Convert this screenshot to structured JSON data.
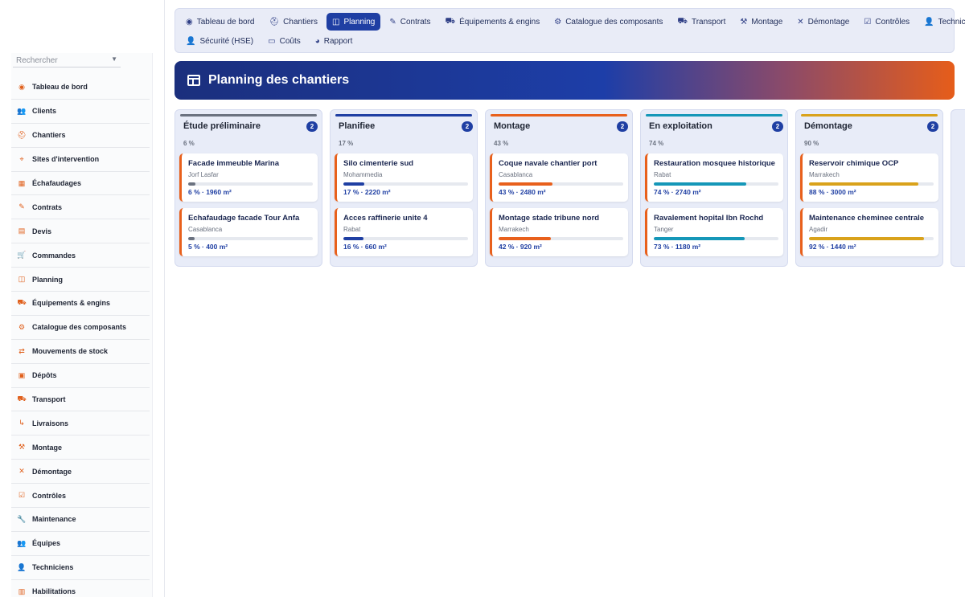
{
  "sidebar": {
    "search_placeholder": "Rechercher",
    "items": [
      {
        "label": "Tableau de bord",
        "icon": "dashboard-icon",
        "glyph": "◉"
      },
      {
        "label": "Clients",
        "icon": "users-icon",
        "glyph": "👥"
      },
      {
        "label": "Chantiers",
        "icon": "helmet-icon",
        "glyph": "⛑"
      },
      {
        "label": "Sites d'intervention",
        "icon": "map-pin-icon",
        "glyph": "⌖"
      },
      {
        "label": "Échafaudages",
        "icon": "grid-icon",
        "glyph": "▦"
      },
      {
        "label": "Contrats",
        "icon": "contract-icon",
        "glyph": "✎"
      },
      {
        "label": "Devis",
        "icon": "document-icon",
        "glyph": "▤"
      },
      {
        "label": "Commandes",
        "icon": "cart-icon",
        "glyph": "🛒"
      },
      {
        "label": "Planning",
        "icon": "calendar-icon",
        "glyph": "◫"
      },
      {
        "label": "Équipements & engins",
        "icon": "truck-icon",
        "glyph": "⛟"
      },
      {
        "label": "Catalogue des composants",
        "icon": "components-icon",
        "glyph": "⚙"
      },
      {
        "label": "Mouvements de stock",
        "icon": "exchange-icon",
        "glyph": "⇄"
      },
      {
        "label": "Dépôts",
        "icon": "warehouse-icon",
        "glyph": "▣"
      },
      {
        "label": "Transport",
        "icon": "transport-icon",
        "glyph": "⛟"
      },
      {
        "label": "Livraisons",
        "icon": "dolly-icon",
        "glyph": "↳"
      },
      {
        "label": "Montage",
        "icon": "hammer-icon",
        "glyph": "⚒"
      },
      {
        "label": "Démontage",
        "icon": "tools-icon",
        "glyph": "✕"
      },
      {
        "label": "Contrôles",
        "icon": "clipboard-check-icon",
        "glyph": "☑"
      },
      {
        "label": "Maintenance",
        "icon": "wrench-icon",
        "glyph": "🔧"
      },
      {
        "label": "Équipes",
        "icon": "team-icon",
        "glyph": "👥"
      },
      {
        "label": "Techniciens",
        "icon": "technician-icon",
        "glyph": "👤"
      },
      {
        "label": "Habilitations",
        "icon": "certificate-icon",
        "glyph": "▥"
      }
    ]
  },
  "topnav": {
    "row1": [
      {
        "label": "Tableau de bord",
        "icon": "dashboard-icon",
        "glyph": "◉",
        "active": false
      },
      {
        "label": "Chantiers",
        "icon": "helmet-icon",
        "glyph": "⛑",
        "active": false
      },
      {
        "label": "Planning",
        "icon": "calendar-icon",
        "glyph": "◫",
        "active": true
      },
      {
        "label": "Contrats",
        "icon": "contract-icon",
        "glyph": "✎",
        "active": false
      },
      {
        "label": "Équipements & engins",
        "icon": "truck-icon",
        "glyph": "⛟",
        "active": false
      },
      {
        "label": "Catalogue des composants",
        "icon": "components-icon",
        "glyph": "⚙",
        "active": false
      },
      {
        "label": "Transport",
        "icon": "transport-icon",
        "glyph": "⛟",
        "active": false
      },
      {
        "label": "Montage",
        "icon": "hammer-icon",
        "glyph": "⚒",
        "active": false
      },
      {
        "label": "Démontage",
        "icon": "tools-icon",
        "glyph": "✕",
        "active": false
      },
      {
        "label": "Contrôles",
        "icon": "clipboard-check-icon",
        "glyph": "☑",
        "active": false
      },
      {
        "label": "Techniciens",
        "icon": "technician-icon",
        "glyph": "👤",
        "active": false
      }
    ],
    "row2": [
      {
        "label": "Sécurité (HSE)",
        "icon": "safety-icon",
        "glyph": "👤",
        "active": false
      },
      {
        "label": "Coûts",
        "icon": "wallet-icon",
        "glyph": "▭",
        "active": false
      },
      {
        "label": "Rapport",
        "icon": "pie-chart-icon",
        "glyph": "◕",
        "active": false
      }
    ]
  },
  "hero": {
    "title": "Planning des chantiers"
  },
  "colors": {
    "accent": "#1f3fa3",
    "orange": "#e8601c",
    "teal": "#1597b8",
    "gold": "#d9a21b",
    "gray": "#6b7280"
  },
  "columns": [
    {
      "title": "Étude préliminaire",
      "count": "2",
      "pct": "6 %",
      "color": "#6b7280",
      "cards": [
        {
          "title": "Facade immeuble Marina",
          "location": "Jorf Lasfar",
          "progress": 6,
          "info": "6 % · 1960 m²"
        },
        {
          "title": "Echafaudage facade Tour Anfa",
          "location": "Casablanca",
          "progress": 5,
          "info": "5 % · 400 m²"
        }
      ]
    },
    {
      "title": "Planifiee",
      "count": "2",
      "pct": "17 %",
      "color": "#1f3fa3",
      "cards": [
        {
          "title": "Silo cimenterie sud",
          "location": "Mohammedia",
          "progress": 17,
          "info": "17 % · 2220 m²"
        },
        {
          "title": "Acces raffinerie unite 4",
          "location": "Rabat",
          "progress": 16,
          "info": "16 % · 660 m²"
        }
      ]
    },
    {
      "title": "Montage",
      "count": "2",
      "pct": "43 %",
      "color": "#e8601c",
      "cards": [
        {
          "title": "Coque navale chantier port",
          "location": "Casablanca",
          "progress": 43,
          "info": "43 % · 2480 m²"
        },
        {
          "title": "Montage stade tribune nord",
          "location": "Marrakech",
          "progress": 42,
          "info": "42 % · 920 m²"
        }
      ]
    },
    {
      "title": "En exploitation",
      "count": "2",
      "pct": "74 %",
      "color": "#1597b8",
      "cards": [
        {
          "title": "Restauration mosquee historique",
          "location": "Rabat",
          "progress": 74,
          "info": "74 % · 2740 m²"
        },
        {
          "title": "Ravalement hopital Ibn Rochd",
          "location": "Tanger",
          "progress": 73,
          "info": "73 % · 1180 m²"
        }
      ]
    },
    {
      "title": "Démontage",
      "count": "2",
      "pct": "90 %",
      "color": "#d9a21b",
      "cards": [
        {
          "title": "Reservoir chimique OCP",
          "location": "Marrakech",
          "progress": 88,
          "info": "88 % · 3000 m²"
        },
        {
          "title": "Maintenance cheminee centrale",
          "location": "Agadir",
          "progress": 92,
          "info": "92 % · 1440 m²"
        }
      ]
    }
  ]
}
